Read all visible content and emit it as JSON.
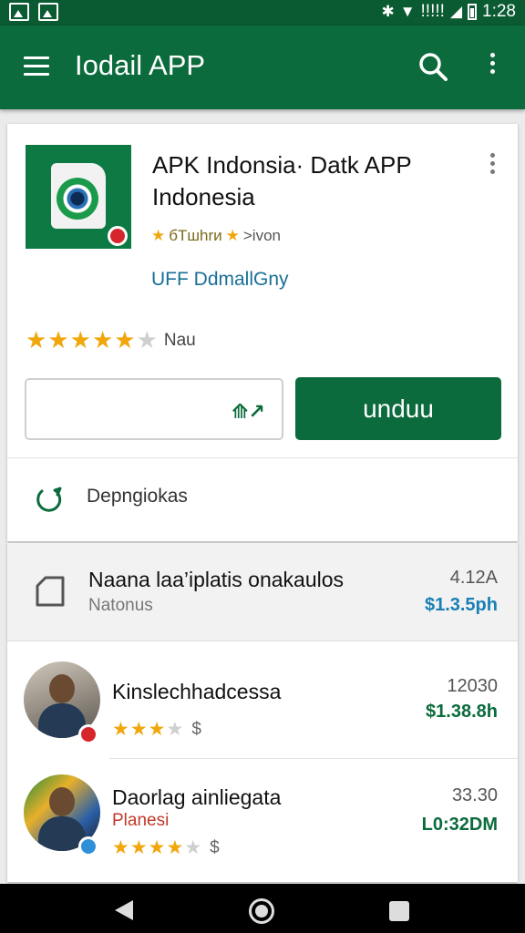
{
  "status_bar": {
    "time": "1:28",
    "signal_text": "!!!!!"
  },
  "app_bar": {
    "title": "Iodail APP"
  },
  "app_card": {
    "title": "APK Indonsia· Datk APP Indonesia",
    "rating_text": "бTшhrи",
    "rating_suffix": ">ivon",
    "link_text": "UFF DdmallGny",
    "stars_label": "Nau",
    "stars_filled": 5,
    "outline_button_icon": "⟰↗",
    "primary_button_label": "unduu",
    "info_label": "Depngiokas"
  },
  "list": {
    "items": [
      {
        "title": "Naana laa’iplatis onakaulos",
        "subtitle": "Natonus",
        "meta": "4.12A",
        "price": "$1.3.5ph"
      },
      {
        "title": "Kinslechhadcessa",
        "meta": "12030",
        "price": "$1.38.8h",
        "rating": 3,
        "dollar": "$"
      },
      {
        "title": "Daorlag ainliegata",
        "subtitle": "Planesi",
        "meta": "33.30",
        "price": "L0:32DM",
        "rating": 4,
        "dollar": "$"
      }
    ]
  },
  "colors": {
    "primary": "#0b6b3c",
    "status_bar": "#0a5a32",
    "star": "#f1a70c",
    "link": "#1a6f97"
  },
  "icons": [
    "image-icon",
    "gallery-icon",
    "bluetooth-icon",
    "wifi-icon",
    "signal-icon",
    "battery-icon",
    "menu-icon",
    "search-icon",
    "more-vert-icon",
    "file-icon",
    "back-icon",
    "home-icon",
    "recents-icon"
  ]
}
